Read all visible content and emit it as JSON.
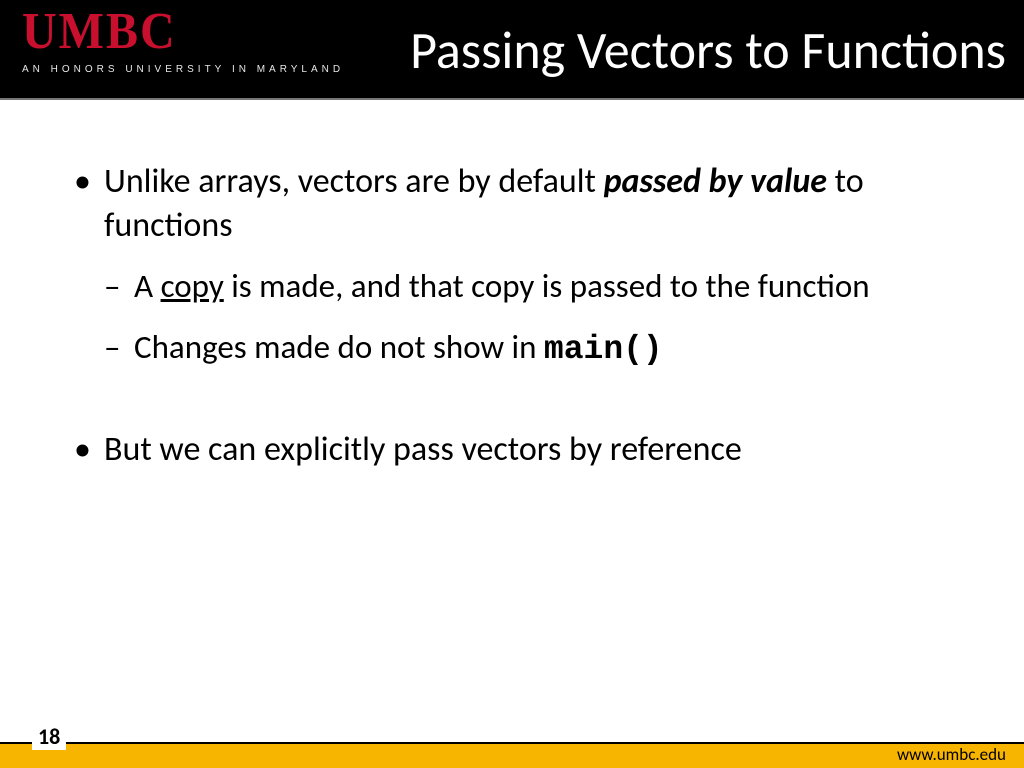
{
  "header": {
    "logo_wordmark": "UMBC",
    "logo_tagline": "AN HONORS UNIVERSITY IN MARYLAND",
    "title": "Passing Vectors to Functions"
  },
  "body": {
    "b1_pre": "Unlike arrays, vectors are by default ",
    "b1_em": "passed by value",
    "b1_post": " to functions",
    "b1_s1_pre": "A ",
    "b1_s1_ul": "copy",
    "b1_s1_post": " is made, and that copy is passed to the function",
    "b1_s2_pre": "Changes made do not show in ",
    "b1_s2_code": "main()",
    "b2": "But we can explicitly pass vectors by reference"
  },
  "footer": {
    "page": "18",
    "url": "www.umbc.edu"
  },
  "colors": {
    "brand_red": "#c8102e",
    "brand_gold": "#f7b500",
    "header_bg": "#000000"
  }
}
